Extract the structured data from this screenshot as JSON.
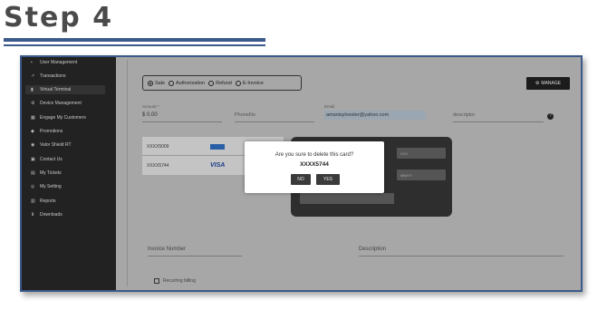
{
  "page": {
    "title": "Step 4"
  },
  "sidebar": {
    "items": [
      {
        "label": "User Management",
        "icon": "users-icon"
      },
      {
        "label": "Transactions",
        "icon": "transactions-icon"
      },
      {
        "label": "Virtual Terminal",
        "icon": "terminal-icon"
      },
      {
        "label": "Device Management",
        "icon": "device-icon"
      },
      {
        "label": "Engage My Customers",
        "icon": "customers-icon"
      },
      {
        "label": "Promotions",
        "icon": "tag-icon"
      },
      {
        "label": "Valor Shield RT",
        "icon": "shield-icon"
      },
      {
        "label": "Contact Us",
        "icon": "contact-icon"
      },
      {
        "label": "My Tickets",
        "icon": "ticket-icon"
      },
      {
        "label": "My Setting",
        "icon": "gear-icon"
      },
      {
        "label": "Reports",
        "icon": "report-icon"
      },
      {
        "label": "Downloads",
        "icon": "download-icon"
      }
    ],
    "active_index": 2
  },
  "transaction_types": [
    {
      "label": "Sale",
      "selected": true
    },
    {
      "label": "Authorization",
      "selected": false
    },
    {
      "label": "Refund",
      "selected": false
    },
    {
      "label": "E-Invoice",
      "selected": false
    }
  ],
  "manage_button": {
    "label": "MANAGE"
  },
  "form": {
    "amount": {
      "label": "Amount *",
      "value": "$ 0.00"
    },
    "phone": {
      "label": "PhoneNo"
    },
    "email": {
      "label": "Email",
      "value": "amanisylvester@yahoo.com"
    },
    "description_top": {
      "label": "descriptor"
    },
    "invoice_number": {
      "label": "Invoice Number"
    },
    "description": {
      "label": "Description"
    },
    "recurring": {
      "label": "Recurring billing"
    }
  },
  "saved_cards": [
    {
      "number": "XXXX5009",
      "brand": "AMEX"
    },
    {
      "number": "XXXX5744",
      "brand": "VISA"
    }
  ],
  "card_form": {
    "cvv_placeholder": "CVV",
    "expiry_placeholder": "MM/YY"
  },
  "modal": {
    "question": "Are you sure to delete this card?",
    "card_number": "XXXX5744",
    "no_label": "NO",
    "yes_label": "YES"
  },
  "colors": {
    "accent": "#3b5a8a",
    "sidebar_bg": "#222222"
  }
}
